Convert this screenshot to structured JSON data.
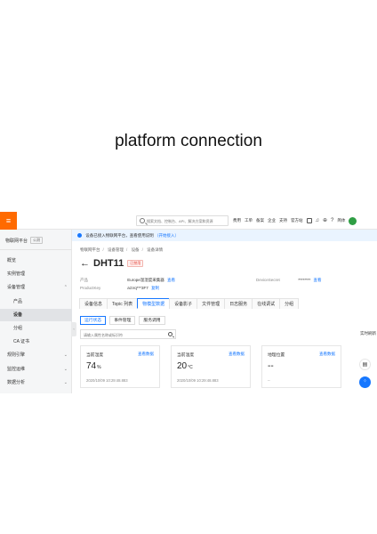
{
  "slide": {
    "title": "platform connection"
  },
  "topbar": {
    "search_placeholder": "搜索文档、控制台、API、解决方案和资源",
    "links": [
      "费用",
      "工单",
      "备案",
      "企业",
      "支持",
      "官方站",
      "简体"
    ]
  },
  "sidebar": {
    "product": "物联网平台",
    "badge": "公测",
    "items": [
      {
        "label": "概览",
        "sub": false,
        "active": false,
        "chevron": ""
      },
      {
        "label": "实例管理",
        "sub": false,
        "active": false,
        "chevron": ""
      },
      {
        "label": "设备管理",
        "sub": false,
        "active": false,
        "chevron": "^"
      },
      {
        "label": "产品",
        "sub": true,
        "active": false,
        "chevron": ""
      },
      {
        "label": "设备",
        "sub": true,
        "active": true,
        "chevron": ""
      },
      {
        "label": "分组",
        "sub": true,
        "active": false,
        "chevron": ""
      },
      {
        "label": "CA 证书",
        "sub": true,
        "active": false,
        "chevron": ""
      },
      {
        "label": "规则引擎",
        "sub": false,
        "active": false,
        "chevron": "v"
      },
      {
        "label": "监控运维",
        "sub": false,
        "active": false,
        "chevron": "v"
      },
      {
        "label": "数据分析",
        "sub": false,
        "active": false,
        "chevron": "v"
      }
    ]
  },
  "notice": {
    "text": "设备已接入物联网平台，查看使用说明",
    "link": "（开始接入）"
  },
  "main": {
    "breadcrumb": [
      "物联网平台",
      "设备管理",
      "设备",
      "设备详情"
    ],
    "device_name": "DHT11",
    "status": "已禁用",
    "meta": {
      "product_label": "产品",
      "product_value": "Europe温湿度采集器",
      "product_link": "查看",
      "productkey_label": "ProductKey",
      "productkey_value": "a1Vq***3F7",
      "productkey_link": "复制",
      "devicesecret_label": "DeviceSecret",
      "devicesecret_value": "********",
      "devicesecret_link": "查看"
    },
    "tabs": [
      "设备信息",
      "Topic 列表",
      "物模型数据",
      "设备影子",
      "文件管理",
      "日志服务",
      "在线调试",
      "分组"
    ],
    "active_tab": 2,
    "subtabs": [
      "运行状态",
      "事件管理",
      "服务调用"
    ],
    "active_subtab": 0,
    "filter_placeholder": "请输入属性名称或标识符",
    "realtime_label": "实时刷新",
    "cards": [
      {
        "name": "当前湿度",
        "link": "查看数据",
        "value": "74",
        "unit": "%",
        "time": "2020/10/09 10:29:48.883"
      },
      {
        "name": "当前温度",
        "link": "查看数据",
        "value": "20",
        "unit": "°C",
        "time": "2020/10/09 10:29:48.883"
      },
      {
        "name": "地理位置",
        "link": "查看数据",
        "value": "--",
        "unit": "",
        "time": "--"
      }
    ]
  },
  "floating": {
    "chat_icon": "chat-icon",
    "apps_icon": "apps-icon"
  },
  "colors": {
    "brand": "#ff6a00",
    "accent": "#1677ff",
    "status_disabled": "#e23b2f"
  }
}
